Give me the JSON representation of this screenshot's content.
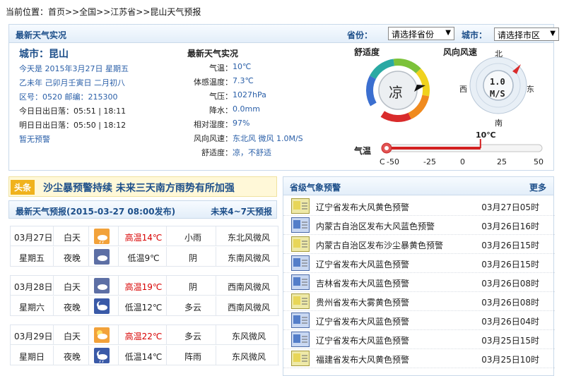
{
  "breadcrumb": {
    "prefix": "当前位置：",
    "home": "首页",
    "sep": ">>",
    "country": "全国",
    "province": "江苏省",
    "page": "昆山天气预报"
  },
  "current": {
    "header_title": "最新天气实况",
    "province_label": "省份：",
    "province_select": "请选择省份",
    "city_label": "城市：",
    "city_select": "请选择市区",
    "city_title": "城市：昆山",
    "today": "今天是 2015年3月27日 星期五",
    "lunar": "乙未年 己卯月壬寅日 二月初八",
    "area_code": "区号：0520  邮编：215300",
    "sun_today": "今日日出日落：05:51 | 18:11",
    "sun_tomorrow": "明日日出日落：05:50 | 18:12",
    "no_warning": "暂无预警",
    "obs_title": "最新天气实况",
    "obs": [
      {
        "label": "气温：",
        "value": "10℃"
      },
      {
        "label": "体感温度：",
        "value": "7.3℃"
      },
      {
        "label": "气压：",
        "value": "1027hPa"
      },
      {
        "label": "降水：",
        "value": "0.0mm"
      },
      {
        "label": "相对湿度：",
        "value": "97%"
      },
      {
        "label": "风向风速：",
        "value": "东北风 微风 1.0M/S"
      },
      {
        "label": "舒适度：",
        "value": "凉，不舒适"
      }
    ],
    "comfort_label": "舒适度",
    "comfort_value": "凉",
    "wind_label": "风向风速",
    "wind_value": "1.0",
    "wind_unit": "M/S",
    "compass": {
      "n": "北",
      "s": "南",
      "e": "东",
      "w": "西"
    },
    "temp_label": "气温",
    "temp_current": "10℃",
    "temp_value": 10,
    "temp_scale": {
      "unit": "C",
      "ticks": [
        "-50",
        "-25",
        "0",
        "25",
        "50"
      ],
      "min": -50,
      "max": 50
    }
  },
  "headline": {
    "tag": "头条",
    "text": "沙尘暴预警持续  未来三天南方雨势有所加强"
  },
  "forecast": {
    "title": "最新天气预报(2015-03-27  08:00发布)",
    "link": "未来4~7天预报",
    "days": [
      {
        "date": "03月27日",
        "weekday": "星期五",
        "day": {
          "period": "白天",
          "temp": "高温14℃",
          "weather": "小雨",
          "wind": "东北风微风",
          "icon": "light-rain-icon"
        },
        "night": {
          "period": "夜晚",
          "temp": "低温9℃",
          "weather": "阴",
          "wind": "东南风微风",
          "icon": "overcast-icon"
        }
      },
      {
        "date": "03月28日",
        "weekday": "星期六",
        "day": {
          "period": "白天",
          "temp": "高温19℃",
          "weather": "阴",
          "wind": "西南风微风",
          "icon": "overcast-icon"
        },
        "night": {
          "period": "夜晚",
          "temp": "低温12℃",
          "weather": "多云",
          "wind": "西南风微风",
          "icon": "cloudy-night-icon"
        }
      },
      {
        "date": "03月29日",
        "weekday": "星期日",
        "day": {
          "period": "白天",
          "temp": "高温22℃",
          "weather": "多云",
          "wind": "东风微风",
          "icon": "partly-cloudy-icon"
        },
        "night": {
          "period": "夜晚",
          "temp": "低温14℃",
          "weather": "阵雨",
          "wind": "东风微风",
          "icon": "shower-night-icon"
        }
      }
    ]
  },
  "alerts": {
    "title": "省级气象预警",
    "more": "更多",
    "items": [
      {
        "text": "辽宁省发布大风黄色预警",
        "time": "03月27日05时",
        "color": "#e6d24a"
      },
      {
        "text": "内蒙古自治区发布大风蓝色预警",
        "time": "03月26日16时",
        "color": "#3f6fc2"
      },
      {
        "text": "内蒙古自治区发布沙尘暴黄色预警",
        "time": "03月26日15时",
        "color": "#e6d24a"
      },
      {
        "text": "辽宁省发布大风蓝色预警",
        "time": "03月26日15时",
        "color": "#3f6fc2"
      },
      {
        "text": "吉林省发布大风蓝色预警",
        "time": "03月26日08时",
        "color": "#3f6fc2"
      },
      {
        "text": "贵州省发布大雾黄色预警",
        "time": "03月26日08时",
        "color": "#e6d24a"
      },
      {
        "text": "辽宁省发布大风蓝色预警",
        "time": "03月26日04时",
        "color": "#3f6fc2"
      },
      {
        "text": "辽宁省发布大风蓝色预警",
        "time": "03月25日15时",
        "color": "#3f6fc2"
      },
      {
        "text": "福建省发布大风黄色预警",
        "time": "03月25日10时",
        "color": "#e6d24a"
      }
    ]
  }
}
